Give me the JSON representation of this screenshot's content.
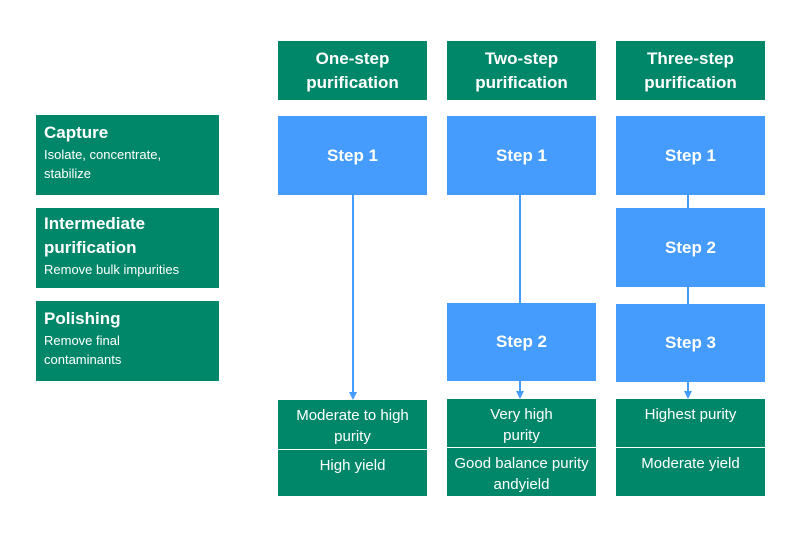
{
  "stages": [
    {
      "title": "Capture",
      "desc": "Isolate, concentrate, stabilize"
    },
    {
      "title": "Intermediate purification",
      "desc": "Remove bulk impurities"
    },
    {
      "title": "Polishing",
      "desc": "Remove final contaminants"
    }
  ],
  "columns": [
    {
      "header": "One-step purification",
      "steps": [
        "Step 1"
      ],
      "results": [
        "Moderate to high purity",
        "High yield"
      ]
    },
    {
      "header": "Two-step purification",
      "steps": [
        "Step 1",
        "Step 2"
      ],
      "results": [
        "Very high purity",
        "Good balance purity andyield"
      ]
    },
    {
      "header": "Three-step purification",
      "steps": [
        "Step 1",
        "Step 2",
        "Step 3"
      ],
      "results": [
        "Highest purity",
        "Moderate yield"
      ]
    }
  ],
  "colors": {
    "green": "#00876a",
    "blue": "#459cfd"
  }
}
